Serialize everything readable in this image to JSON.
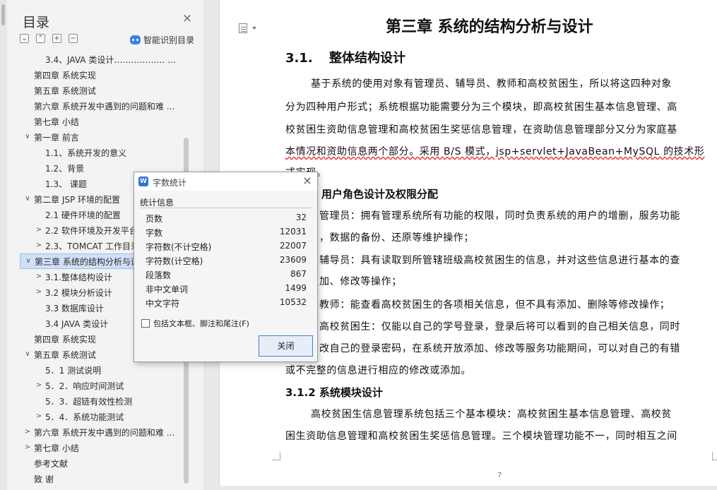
{
  "outline": {
    "title": "目录",
    "smart_toc_label": "智能识别目录",
    "items": [
      {
        "label": "3.4、JAVA 类设计……………… …",
        "level": 2,
        "chevron": ""
      },
      {
        "label": "第四章 系统实现",
        "level": 1,
        "chevron": ""
      },
      {
        "label": "第五章 系统测试",
        "level": 1,
        "chevron": ""
      },
      {
        "label": "第六章 系统开发中遇到的问题和难 …",
        "level": 1,
        "chevron": ""
      },
      {
        "label": "第七章 小结",
        "level": 1,
        "chevron": ""
      },
      {
        "label": "第一章 前言",
        "level": 1,
        "chevron": "∨"
      },
      {
        "label": "1.1、系统开发的意义",
        "level": 2,
        "chevron": ""
      },
      {
        "label": "1.2、背景",
        "level": 2,
        "chevron": ""
      },
      {
        "label": "1.3、 课题",
        "level": 2,
        "chevron": ""
      },
      {
        "label": "第二章 JSP 环境的配置",
        "level": 1,
        "chevron": "∨"
      },
      {
        "label": "2.1 硬件环境的配置",
        "level": 2,
        "chevron": ""
      },
      {
        "label": "2.2 软件环境及开发平台",
        "level": 2,
        "chevron": ">"
      },
      {
        "label": "2.3、TOMCAT 工作目录",
        "level": 2,
        "chevron": ">"
      },
      {
        "label": "第三章 系统的结构分析与设计",
        "level": 1,
        "chevron": "∨",
        "selected": true
      },
      {
        "label": "3.1.整体结构设计",
        "level": 2,
        "chevron": ">"
      },
      {
        "label": "3.2 模块分析设计",
        "level": 2,
        "chevron": ">"
      },
      {
        "label": "3.3 数据库设计",
        "level": 2,
        "chevron": ""
      },
      {
        "label": "3.4 JAVA 类设计",
        "level": 2,
        "chevron": ""
      },
      {
        "label": "第四章 系统实现",
        "level": 1,
        "chevron": ""
      },
      {
        "label": "第五章 系统测试",
        "level": 1,
        "chevron": "∨"
      },
      {
        "label": "5．1 测试说明",
        "level": 2,
        "chevron": ""
      },
      {
        "label": "5．2．响应时间测试",
        "level": 2,
        "chevron": ">"
      },
      {
        "label": "5．3．超链有效性检测",
        "level": 2,
        "chevron": ""
      },
      {
        "label": "5．4．系统功能测试",
        "level": 2,
        "chevron": ">"
      },
      {
        "label": "第六章 系统开发中遇到的问题和难 …",
        "level": 1,
        "chevron": ">"
      },
      {
        "label": "第七章 小结",
        "level": 1,
        "chevron": ">"
      },
      {
        "label": "参考文献",
        "level": 1,
        "chevron": ""
      },
      {
        "label": "致 谢",
        "level": 1,
        "chevron": ""
      }
    ]
  },
  "document": {
    "chapter_title": "第三章 系统的结构分析与设计",
    "section_num": "3.1.",
    "section_title": "整体结构设计",
    "lines": [
      "基于系统的使用对象有管理员、辅导员、教师和高校贫困生，所以将这四种对象",
      "分为四种用户形式；系统根据功能需要分为三个模块，即高校贫困生基本信息管理、高",
      "校贫困生资助信息管理和高校贫困生奖惩信息管理，在资助信息管理部分又分为家庭基",
      "本情况和资助信息两个部分。采用 B/S 模式，jsp+servlet+JavaBean+MySQL 的技术形",
      "式实现。"
    ],
    "subhead_311": "用户角色设计及权限分配",
    "role_lines": [
      "管理员：拥有管理系统所有功能的权限，同时负责系统的用户的增删，服务功能",
      "，数据的备份、还原等维护操作；",
      "辅导员：具有读取到所管辖班级高校贫困生的信息，并对这些信息进行基本的查",
      "加、修改等操作；",
      "教师：能查看高校贫困生的各项相关信息，但不具有添加、删除等修改操作；",
      "高校贫困生：仅能以自己的学号登录，登录后将可以看到的自己相关信息，同时",
      "改自己的登录密码，在系统开放添加、修改等服务功能期间，可以对自己的有错",
      "或不完整的信息进行相应的修改或添加。"
    ],
    "subhead_312": "3.1.2 系统模块设计",
    "module_lines": [
      "高校贫困生信息管理系统包括三个基本模块：高校贫困生基本信息管理、高校贫",
      "困生资助信息管理和高校贫困生奖惩信息管理。三个模块管理功能不一，同时相互之间"
    ],
    "page_number": "7"
  },
  "dialog": {
    "title": "字数统计",
    "group_label": "统计信息",
    "stats": [
      {
        "label": "页数",
        "value": "32"
      },
      {
        "label": "字数",
        "value": "12031"
      },
      {
        "label": "字符数(不计空格)",
        "value": "22007"
      },
      {
        "label": "字符数(计空格)",
        "value": "23609"
      },
      {
        "label": "段落数",
        "value": "867"
      },
      {
        "label": "非中文单词",
        "value": "1499"
      },
      {
        "label": "中文字符",
        "value": "10532"
      }
    ],
    "checkbox_label": "包括文本框、脚注和尾注(F)",
    "close_label": "关闭"
  }
}
